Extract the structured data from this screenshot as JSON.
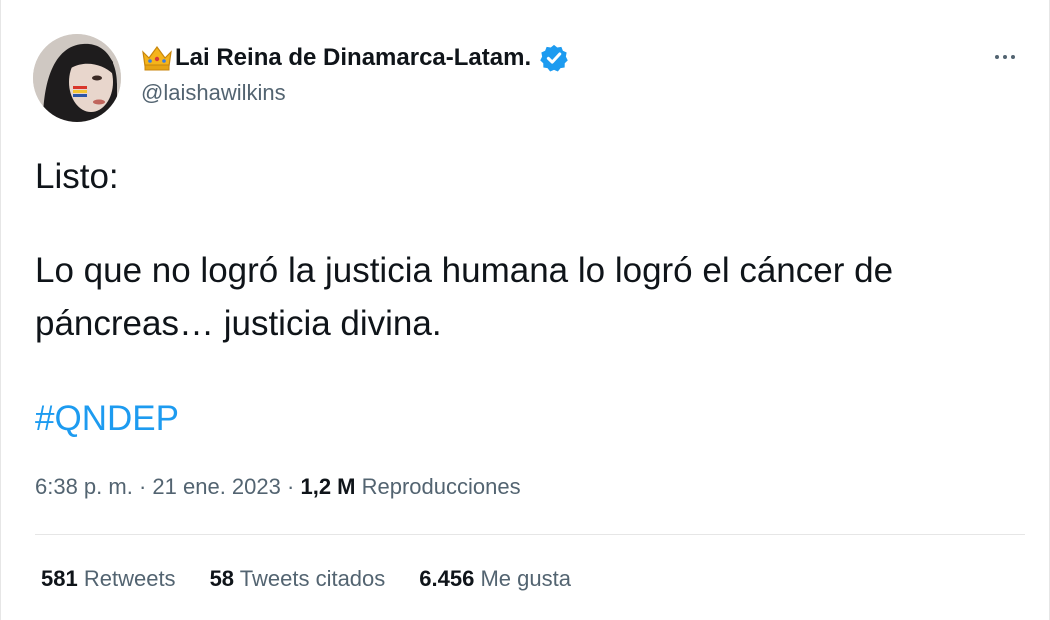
{
  "author": {
    "display_name": "Lai Reina de Dinamarca-Latam.",
    "handle": "@laishawilkins",
    "avatar_icon": "profile-photo",
    "name_emoji_icon": "crown-icon",
    "verified_icon": "verified-badge-icon",
    "verified_color": "#1d9bf0"
  },
  "menu": {
    "icon": "more-options-icon"
  },
  "tweet": {
    "line1": "Listo:",
    "line2": "Lo que no logró la justicia humana lo logró el cáncer de páncreas… justicia divina.",
    "hashtag": "#QNDEP",
    "hashtag_color": "#1d9bf0"
  },
  "meta": {
    "time": "6:38 p. m.",
    "separator": "·",
    "date": "21 ene. 2023",
    "views_count": "1,2 M",
    "views_label": "Reproducciones"
  },
  "stats": [
    {
      "count": "581",
      "label": "Retweets"
    },
    {
      "count": "58",
      "label": "Tweets citados"
    },
    {
      "count": "6.456",
      "label": "Me gusta"
    }
  ]
}
